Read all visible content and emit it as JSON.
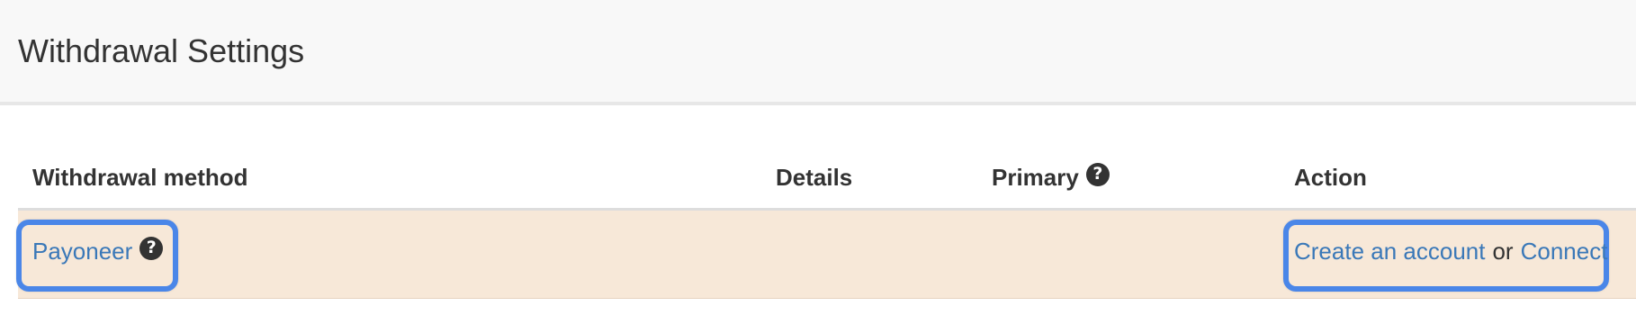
{
  "header": {
    "title": "Withdrawal Settings"
  },
  "table": {
    "columns": {
      "method": "Withdrawal method",
      "details": "Details",
      "primary": "Primary",
      "action": "Action"
    },
    "rows": [
      {
        "method": "Payoneer",
        "details": "",
        "primary": "",
        "action": {
          "create_label": "Create an account",
          "separator": "or",
          "connect_label": "Connect"
        }
      }
    ]
  },
  "icons": {
    "help": "question-circle-icon"
  },
  "colors": {
    "header_bg": "#f8f8f8",
    "row_highlight_bg": "#f7e8d8",
    "link": "#3a78b8",
    "highlight_border": "#4a86e8"
  }
}
